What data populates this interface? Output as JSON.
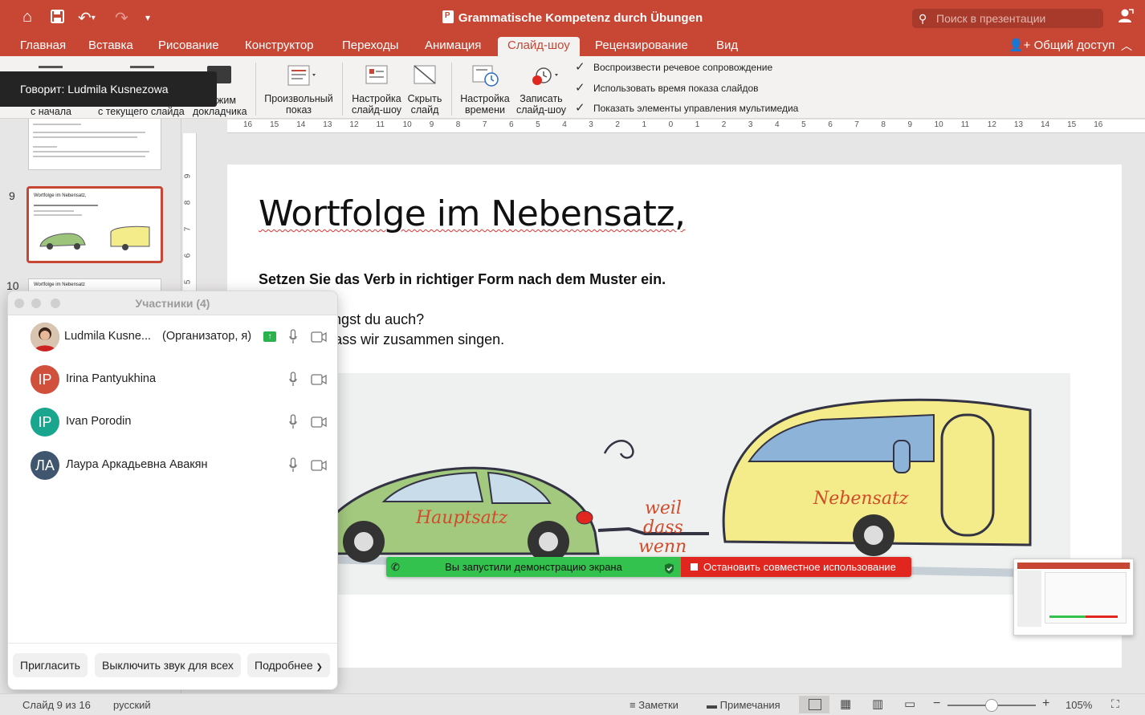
{
  "app": {
    "document_title": "Grammatische Kompetenz durch Übungen",
    "search_placeholder": "Поиск в презентации",
    "share_label": "Общий доступ",
    "icons": [
      "home-icon",
      "save-icon",
      "undo-icon",
      "redo-icon",
      "customize-icon",
      "user-icon"
    ]
  },
  "tabs": [
    {
      "label": "Главная"
    },
    {
      "label": "Вставка"
    },
    {
      "label": "Рисование"
    },
    {
      "label": "Конструктор"
    },
    {
      "label": "Переходы"
    },
    {
      "label": "Анимация"
    },
    {
      "label": "Слайд-шоу",
      "active": true
    },
    {
      "label": "Рецензирование"
    },
    {
      "label": "Вид"
    }
  ],
  "ribbon": {
    "from_start": "с начала",
    "from_current": "с текущего слайда",
    "presenter_line1": "жим",
    "presenter_line2": "докладчика",
    "custom_show_line1": "Произвольный",
    "custom_show_line2": "показ",
    "setup_line1": "Настройка",
    "setup_line2": "слайд-шоу",
    "hide_line1": "Скрыть",
    "hide_line2": "слайд",
    "timing_line1": "Настройка",
    "timing_line2": "времени",
    "record_line1": "Записать",
    "record_line2": "слайд-шоу",
    "checks": [
      {
        "label": "Воспроизвести речевое сопровождение",
        "checked": true
      },
      {
        "label": "Использовать время показа слайдов",
        "checked": true
      },
      {
        "label": "Показать элементы управления мультимедиа",
        "checked": true
      }
    ]
  },
  "speaking_banner": "Говорит: Ludmila Kusnezowa",
  "thumbnails": {
    "slide9_number": "9",
    "slide9_title": "Wortfolge im Nebensatz,",
    "slide10_number": "10",
    "slide10_title": "Wortfolge im Nebensatz"
  },
  "ruler": {
    "h_ticks": [
      "16",
      "15",
      "14",
      "13",
      "12",
      "11",
      "10",
      "9",
      "8",
      "7",
      "6",
      "5",
      "4",
      "3",
      "2",
      "1",
      "0",
      "1",
      "2",
      "3",
      "4",
      "5",
      "6",
      "7",
      "8",
      "9",
      "10",
      "11",
      "12",
      "13",
      "14",
      "15",
      "16"
    ],
    "v_ticks": [
      "9",
      "8",
      "7",
      "6",
      "5"
    ]
  },
  "slide": {
    "title": "Wortfolge im Nebensatz,",
    "subtitle": "Setzen Sie das Verb in richtiger Form nach dem Muster ein.",
    "line1": "ch singe. Singst du auch?",
    "line2": "de es gut, dass wir zusammen singen.",
    "car_label": "Hauptsatz",
    "trailer_label": "Nebensatz",
    "conj1": "weil",
    "conj2": "dass",
    "conj3": "wenn"
  },
  "participants": {
    "title": "Участники (4)",
    "list": [
      {
        "name": "Ludmila Kusne...",
        "role": "(Организатор, я)",
        "initials": "",
        "color": "#8a5a44"
      },
      {
        "name": "Irina Pantyukhina",
        "role": "",
        "initials": "IP",
        "color": "#d0503b"
      },
      {
        "name": "Ivan Porodin",
        "role": "",
        "initials": "IP",
        "color": "#1aa58f"
      },
      {
        "name": "Лаура Аркадьевна Авакян",
        "role": "",
        "initials": "ЛА",
        "color": "#3f566e"
      }
    ],
    "invite_label": "Пригласить",
    "mute_all_label": "Выключить звук для всех",
    "more_label": "Подробнее"
  },
  "share_bar": {
    "status": "Вы запустили демонстрацию экрана",
    "stop": "Остановить совместное использование"
  },
  "status_bar": {
    "slide_info": "Слайд 9 из 16",
    "language": "русский",
    "notes": "Заметки",
    "comments": "Примечания",
    "zoom": "105%",
    "zoom_fraction": 0.5
  }
}
